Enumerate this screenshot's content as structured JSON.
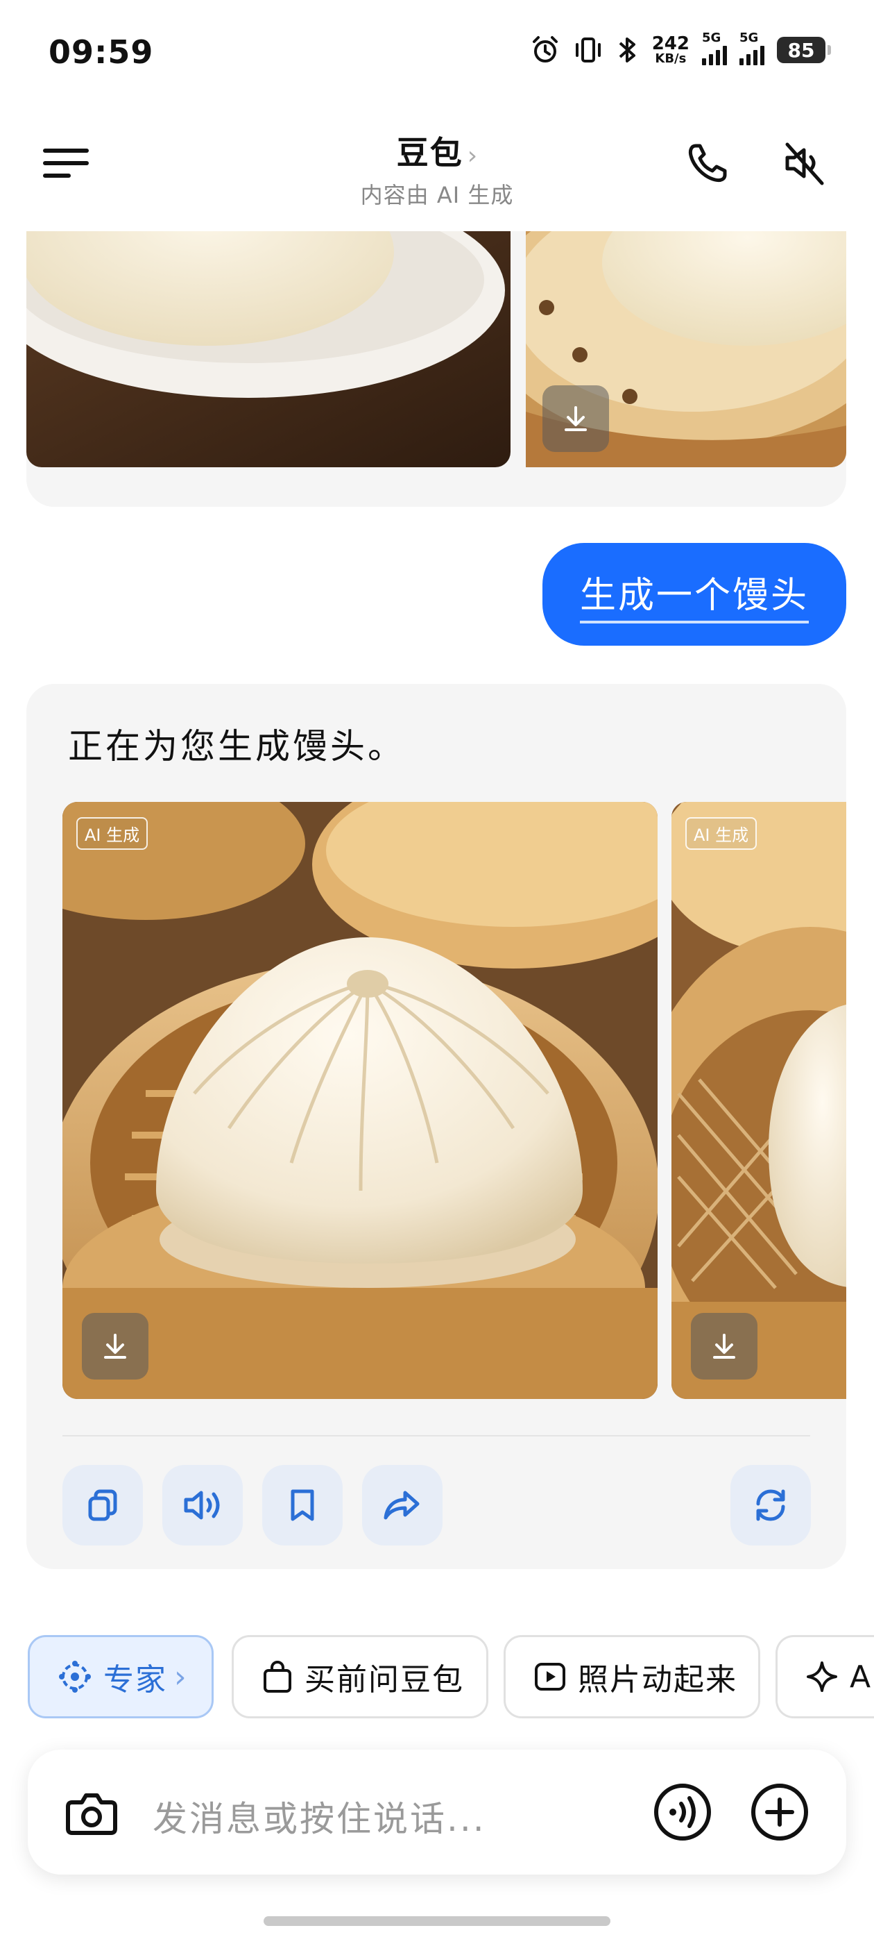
{
  "status_bar": {
    "time": "09:59",
    "net_speed_value": "242",
    "net_speed_unit": "KB/s",
    "signal1_label": "5G",
    "signal2_label": "5G",
    "battery": "85"
  },
  "header": {
    "title": "豆包",
    "title_chevron": "›",
    "subtitle": "内容由 AI 生成"
  },
  "conversation": {
    "user_message": "生成一个馒头",
    "reply_text": "正在为您生成馒头。",
    "images": [
      {
        "badge": "AI 生成",
        "icon": "download-icon"
      },
      {
        "badge": "AI 生成",
        "icon": "download-icon"
      }
    ],
    "actions": [
      {
        "name": "copy",
        "icon": "copy-icon"
      },
      {
        "name": "read-aloud",
        "icon": "speaker-icon"
      },
      {
        "name": "bookmark",
        "icon": "bookmark-icon"
      },
      {
        "name": "share",
        "icon": "share-icon"
      },
      {
        "name": "regenerate",
        "icon": "refresh-icon"
      }
    ]
  },
  "quick_chips": [
    {
      "label": "专家",
      "suffix": "›",
      "icon": "expert-icon"
    },
    {
      "label": "买前问豆包",
      "icon": "shopping-bag-icon"
    },
    {
      "label": "照片动起来",
      "icon": "play-icon"
    },
    {
      "label": "A",
      "icon": "sparkle-icon"
    }
  ],
  "input": {
    "placeholder": "发消息或按住说话..."
  },
  "colors": {
    "accent": "#1a6dff",
    "card_bg": "#f5f5f5",
    "action_bg": "#e7edf7",
    "action_icon": "#2b6fd6"
  }
}
